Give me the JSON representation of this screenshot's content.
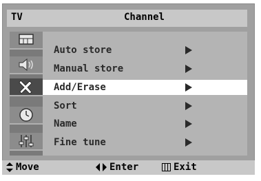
{
  "header": {
    "tab_label": "TV",
    "title": "Channel"
  },
  "sidebar": {
    "icons": [
      {
        "name": "picture-icon"
      },
      {
        "name": "sound-icon"
      },
      {
        "name": "channel-icon",
        "active": true
      },
      {
        "name": "clock-icon"
      },
      {
        "name": "setup-icon"
      }
    ]
  },
  "menu": {
    "items": [
      {
        "label": "Auto store",
        "selected": false
      },
      {
        "label": "Manual store",
        "selected": false
      },
      {
        "label": "Add/Erase",
        "selected": true
      },
      {
        "label": "Sort",
        "selected": false
      },
      {
        "label": "Name",
        "selected": false
      },
      {
        "label": "Fine tune",
        "selected": false
      }
    ]
  },
  "footer": {
    "move_label": "Move",
    "enter_label": "Enter",
    "exit_label": "Exit"
  }
}
